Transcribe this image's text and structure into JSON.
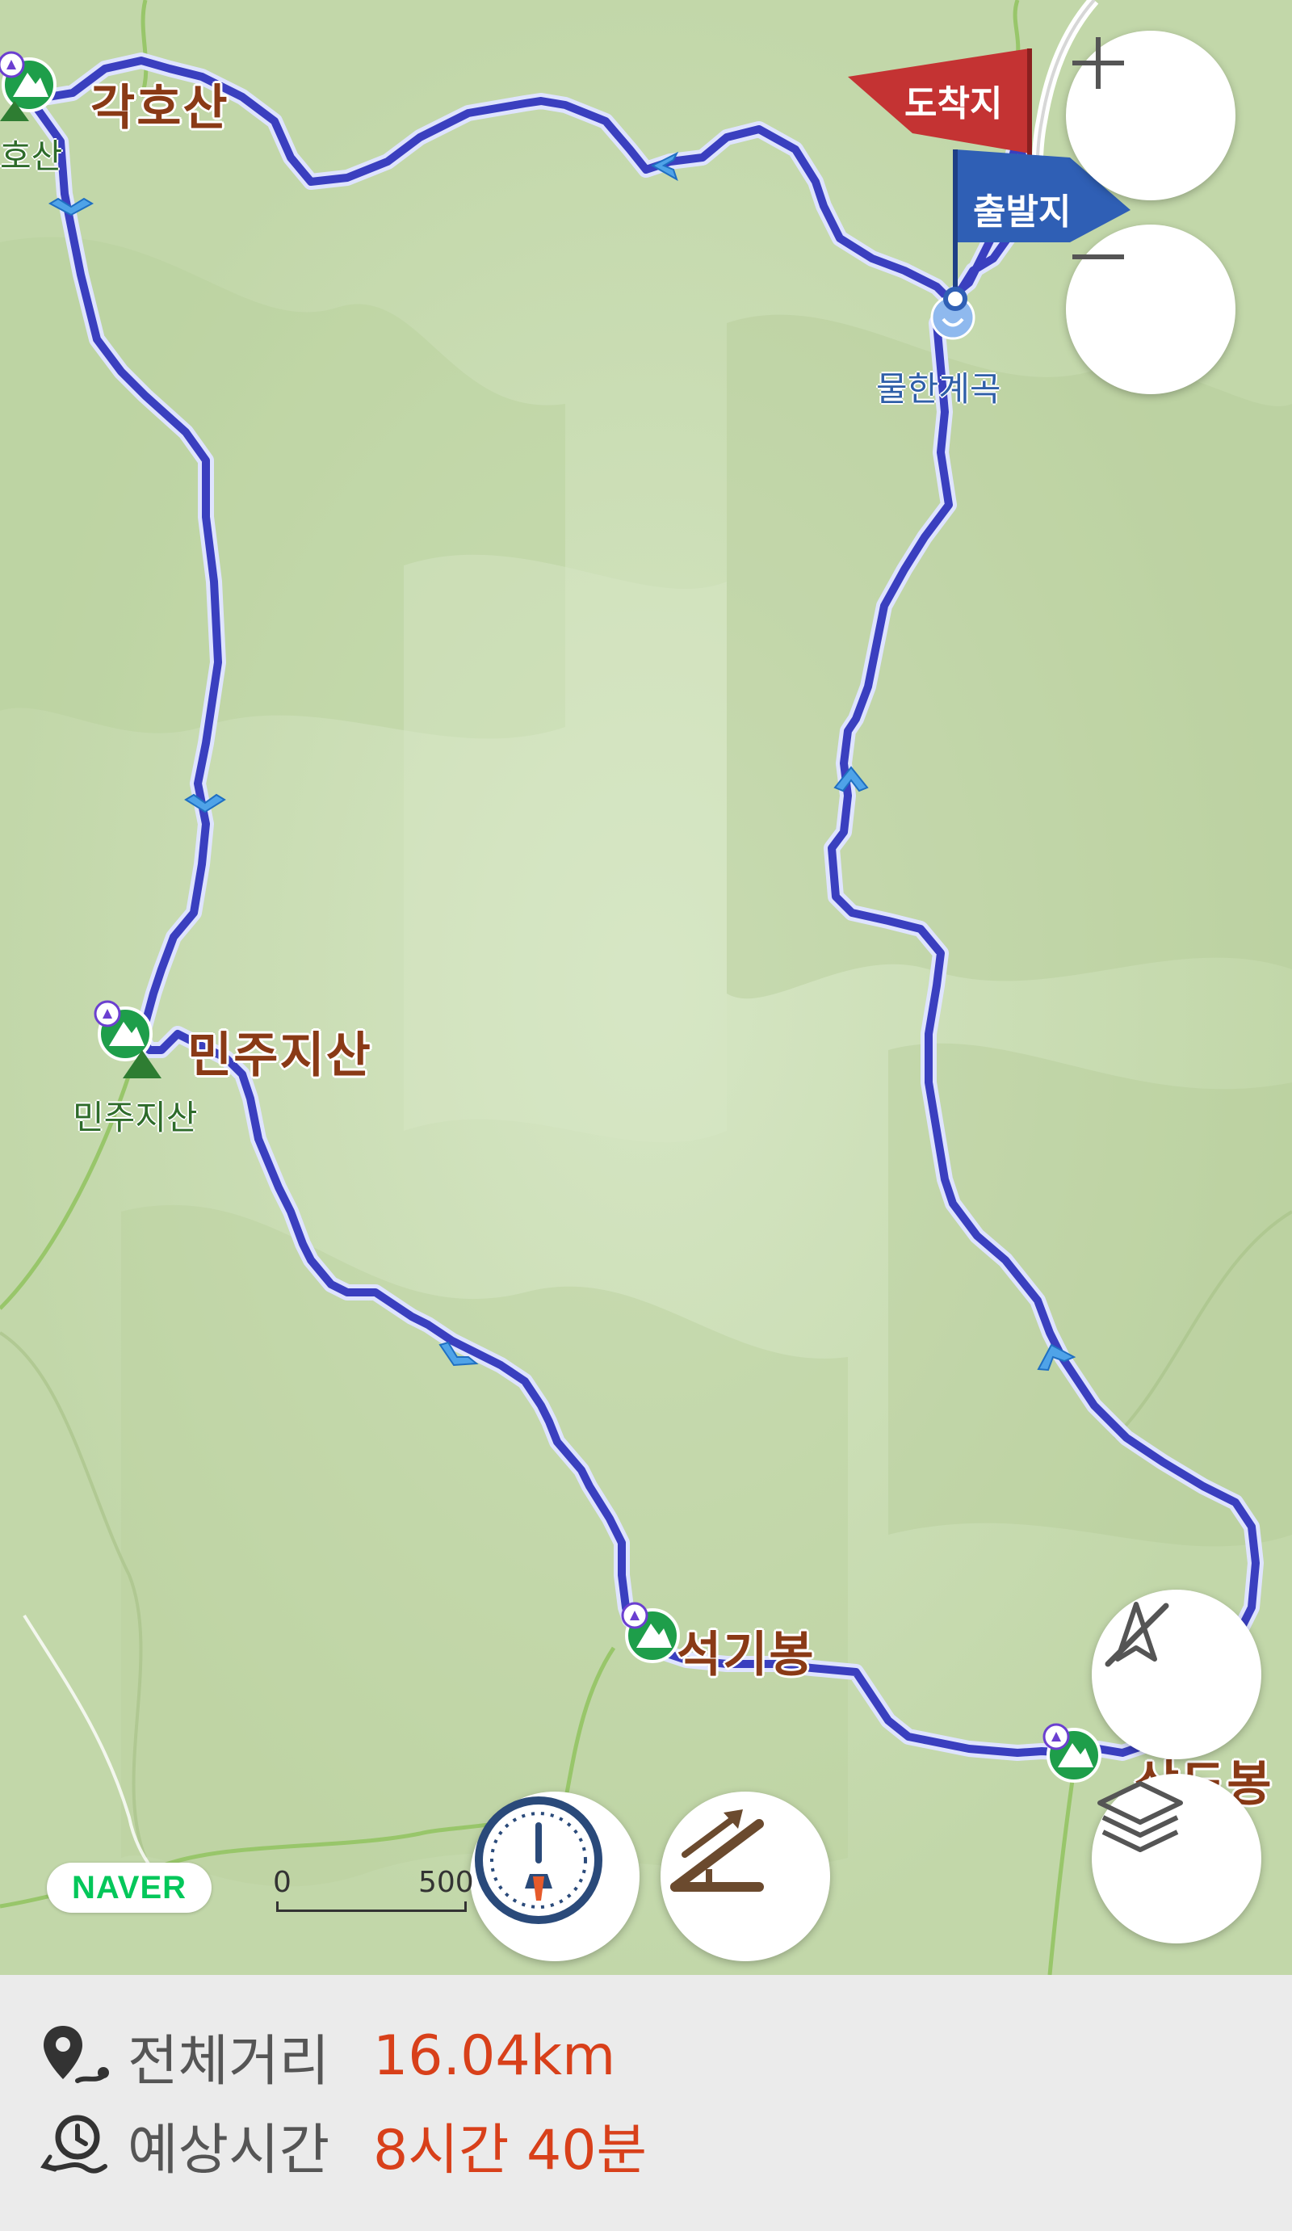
{
  "map": {
    "peaks": {
      "gakhosan": "각호산",
      "gakhosan_small": "호산",
      "minjujisan": "민주지산",
      "minjujisan_small": "민주지산",
      "seokgibong": "석기봉",
      "sambong": "삼도봉"
    },
    "valley": "물한계곡",
    "arrival_flag": "도착지",
    "departure_flag": "출발지",
    "brand": "NAVER",
    "scale_start": "0",
    "scale_end": "500",
    "colors": {
      "terrain": "#c9dcb2",
      "route": "#3a3fbf",
      "route_border": "#dfe4ff",
      "arrival_flag": "#c43333",
      "departure_flag": "#2f5fb5",
      "peak_marker": "#1e9e4a",
      "value_text": "#d8401a"
    }
  },
  "controls": {
    "zoom_in": "+",
    "zoom_out": "−",
    "zoom_in_icon": "plus-icon",
    "zoom_out_icon": "minus-icon",
    "compass_icon": "compass-off-icon",
    "layers_icon": "layers-icon",
    "speed_icon": "speedometer-icon",
    "slope_icon": "slope-icon"
  },
  "summary": {
    "distance_label": "전체거리",
    "distance_value": "16.04km",
    "time_label": "예상시간",
    "time_value": "8시간 40분",
    "distance_icon": "route-pin-icon",
    "time_icon": "clock-route-icon"
  }
}
